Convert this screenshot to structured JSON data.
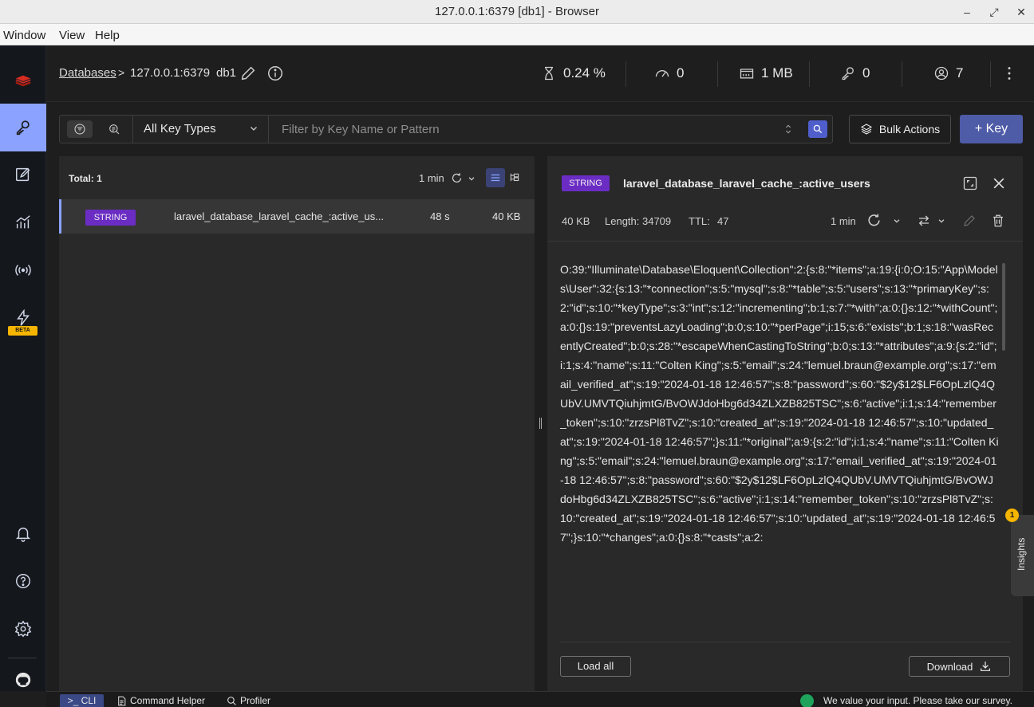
{
  "window": {
    "title": "127.0.0.1:6379 [db1] - Browser",
    "menu": [
      "Window",
      "View",
      "Help"
    ]
  },
  "sidebar": {
    "beta_label": "BETA",
    "items": [
      {
        "icon": "key-icon",
        "active": true
      },
      {
        "icon": "workbench-icon"
      },
      {
        "icon": "analysis-icon"
      },
      {
        "icon": "pubsub-icon"
      },
      {
        "icon": "triggers-icon",
        "badge": "BETA"
      },
      {
        "icon": "notifications-icon"
      },
      {
        "icon": "help-icon"
      },
      {
        "icon": "settings-icon"
      },
      {
        "icon": "github-icon"
      }
    ]
  },
  "header": {
    "breadcrumb_databases": "Databases",
    "breadcrumb_sep": ">",
    "host": "127.0.0.1:6379",
    "db": "db1",
    "stats": {
      "cpu": "0.24 %",
      "ops": "0",
      "memory": "1 MB",
      "keys": "0",
      "clients": "7"
    }
  },
  "filter": {
    "key_type": "All Key Types",
    "search_placeholder": "Filter by Key Name or Pattern",
    "bulk_actions": "Bulk Actions",
    "add_key": "+ Key"
  },
  "keylist": {
    "total": "Total: 1",
    "refresh_time": "1 min",
    "rows": [
      {
        "type": "STRING",
        "name": "laravel_database_laravel_cache_:active_us...",
        "ttl": "48 s",
        "size": "40 KB"
      }
    ]
  },
  "details": {
    "type": "STRING",
    "key_name": "laravel_database_laravel_cache_:active_users",
    "size": "40 KB",
    "length": "Length: 34709",
    "ttl_label": "TTL:",
    "ttl_value": "47",
    "refresh_time": "1 min",
    "value_text": "O:39:\"Illuminate\\Database\\Eloquent\\Collection\":2:{s:8:\"*items\";a:19:{i:0;O:15:\"App\\Models\\User\":32:{s:13:\"*connection\";s:5:\"mysql\";s:8:\"*table\";s:5:\"users\";s:13:\"*primaryKey\";s:2:\"id\";s:10:\"*keyType\";s:3:\"int\";s:12:\"incrementing\";b:1;s:7:\"*with\";a:0:{}s:12:\"*withCount\";a:0:{}s:19:\"preventsLazyLoading\";b:0;s:10:\"*perPage\";i:15;s:6:\"exists\";b:1;s:18:\"wasRecentlyCreated\";b:0;s:28:\"*escapeWhenCastingToString\";b:0;s:13:\"*attributes\";a:9:{s:2:\"id\";i:1;s:4:\"name\";s:11:\"Colten King\";s:5:\"email\";s:24:\"lemuel.braun@example.org\";s:17:\"email_verified_at\";s:19:\"2024-01-18 12:46:57\";s:8:\"password\";s:60:\"$2y$12$LF6OpLzlQ4QUbV.UMVTQiuhjmtG/BvOWJdoHbg6d34ZLXZB825TSC\";s:6:\"active\";i:1;s:14:\"remember_token\";s:10:\"zrzsPl8TvZ\";s:10:\"created_at\";s:19:\"2024-01-18 12:46:57\";s:10:\"updated_at\";s:19:\"2024-01-18 12:46:57\";}s:11:\"*original\";a:9:{s:2:\"id\";i:1;s:4:\"name\";s:11:\"Colten King\";s:5:\"email\";s:24:\"lemuel.braun@example.org\";s:17:\"email_verified_at\";s:19:\"2024-01-18 12:46:57\";s:8:\"password\";s:60:\"$2y$12$LF6OpLzlQ4QUbV.UMVTQiuhjmtG/BvOWJdoHbg6d34ZLXZB825TSC\";s:6:\"active\";i:1;s:14:\"remember_token\";s:10:\"zrzsPl8TvZ\";s:10:\"created_at\";s:19:\"2024-01-18 12:46:57\";s:10:\"updated_at\";s:19:\"2024-01-18 12:46:57\";}s:10:\"*changes\";a:0:{}s:8:\"*casts\";a:2:",
    "load_all": "Load all",
    "download": "Download"
  },
  "insights": {
    "label": "Insights",
    "count": "1"
  },
  "bottombar": {
    "cli": ">_ CLI",
    "command_helper": "Command Helper",
    "profiler": "Profiler",
    "survey": "We value your input. Please take our survey."
  },
  "colors": {
    "accent": "#8ba2ff",
    "string_badge": "#6b2cc4",
    "primary_button": "#4e5ba6",
    "beta": "#f5b400"
  }
}
